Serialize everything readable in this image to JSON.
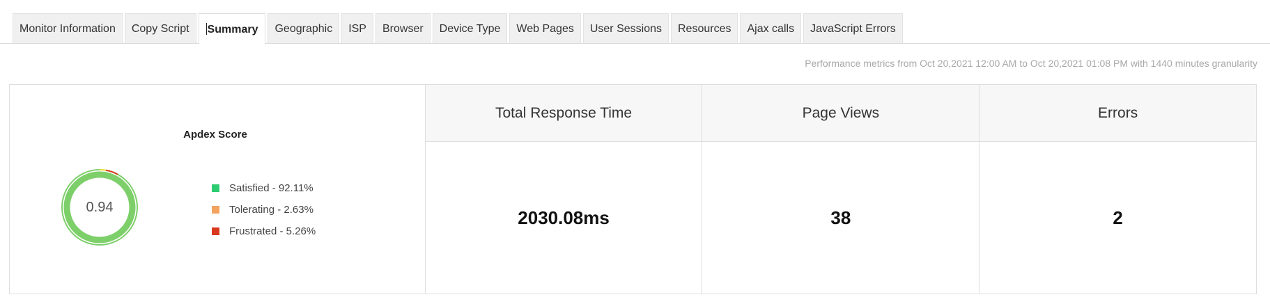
{
  "tabs": [
    {
      "label": "Monitor Information",
      "active": false
    },
    {
      "label": "Copy Script",
      "active": false
    },
    {
      "label": "Summary",
      "active": true
    },
    {
      "label": "Geographic",
      "active": false
    },
    {
      "label": "ISP",
      "active": false
    },
    {
      "label": "Browser",
      "active": false
    },
    {
      "label": "Device Type",
      "active": false
    },
    {
      "label": "Web Pages",
      "active": false
    },
    {
      "label": "User Sessions",
      "active": false
    },
    {
      "label": "Resources",
      "active": false
    },
    {
      "label": "Ajax calls",
      "active": false
    },
    {
      "label": "JavaScript Errors",
      "active": false
    }
  ],
  "meta": {
    "text": "Performance metrics from Oct 20,2021 12:00 AM to Oct 20,2021 01:08 PM with 1440 minutes granularity"
  },
  "apdex": {
    "title": "Apdex Score",
    "score": "0.94",
    "legend": [
      {
        "label": "Satisfied - 92.11%",
        "color": "#2ecc71",
        "percent": 92.11
      },
      {
        "label": "Tolerating - 2.63%",
        "color": "#f4a460",
        "percent": 2.63
      },
      {
        "label": "Frustrated - 5.26%",
        "color": "#d9381e",
        "percent": 5.26
      }
    ],
    "ring_colors": {
      "satisfied": "#7dcf6a",
      "tolerating": "#f2e23a",
      "frustrated": "#d9381e"
    }
  },
  "metrics": [
    {
      "title": "Total Response Time",
      "value": "2030.08ms"
    },
    {
      "title": "Page Views",
      "value": "38"
    },
    {
      "title": "Errors",
      "value": "2"
    }
  ]
}
